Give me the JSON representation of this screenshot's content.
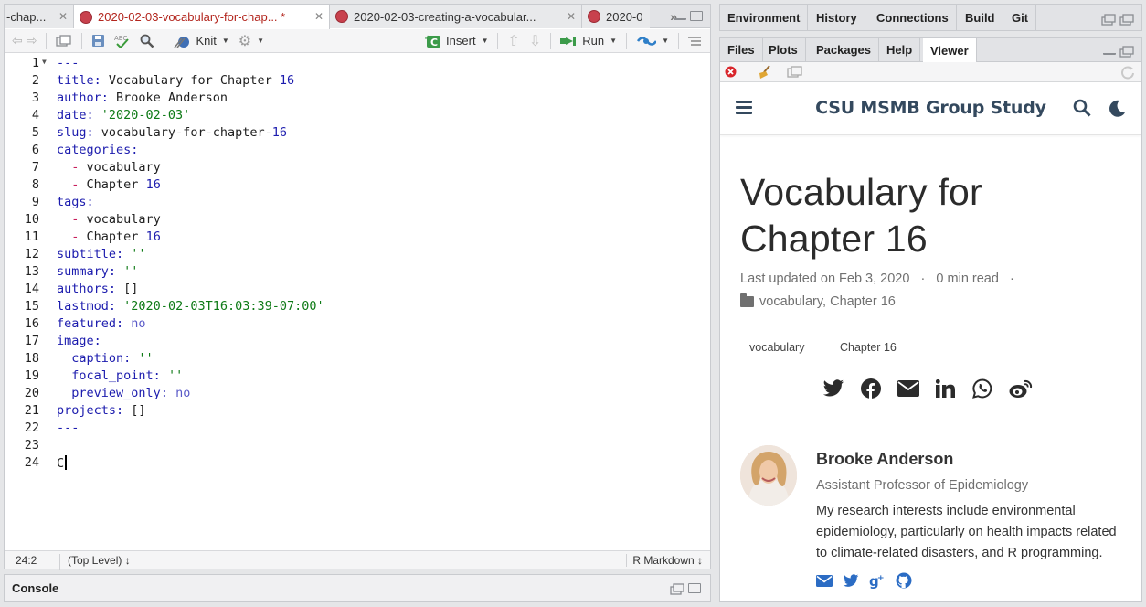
{
  "editor": {
    "tabs": [
      {
        "label": "-chap...",
        "active": false
      },
      {
        "label": "2020-02-03-vocabulary-for-chap... *",
        "active": true
      },
      {
        "label": "2020-02-03-creating-a-vocabular...",
        "active": false
      },
      {
        "label": "2020-0",
        "active": false
      }
    ],
    "toolbar": {
      "knit_label": "Knit",
      "insert_label": "Insert",
      "run_label": "Run"
    },
    "lines": [
      {
        "n": "1",
        "fold": true
      },
      {
        "n": "2"
      },
      {
        "n": "3"
      },
      {
        "n": "4"
      },
      {
        "n": "5"
      },
      {
        "n": "6"
      },
      {
        "n": "7"
      },
      {
        "n": "8"
      },
      {
        "n": "9"
      },
      {
        "n": "10"
      },
      {
        "n": "11"
      },
      {
        "n": "12"
      },
      {
        "n": "13"
      },
      {
        "n": "14"
      },
      {
        "n": "15"
      },
      {
        "n": "16"
      },
      {
        "n": "17"
      },
      {
        "n": "18"
      },
      {
        "n": "19"
      },
      {
        "n": "20"
      },
      {
        "n": "21"
      },
      {
        "n": "22"
      },
      {
        "n": "23"
      },
      {
        "n": "24"
      }
    ],
    "code": {
      "l1": "---",
      "l2_key": "title:",
      "l2_val": "Vocabulary for Chapter ",
      "l2_num": "16",
      "l3_key": "author:",
      "l3_val": "Brooke Anderson",
      "l4_key": "date:",
      "l4_val": "'2020-02-03'",
      "l5_key": "slug:",
      "l5_val": "vocabulary-for-chapter-",
      "l5_num": "16",
      "l6_key": "categories:",
      "l7_dash": "  -",
      "l7_val": "vocabulary",
      "l8_dash": "  -",
      "l8_val": "Chapter ",
      "l8_num": "16",
      "l9_key": "tags:",
      "l10_dash": "  -",
      "l10_val": "vocabulary",
      "l11_dash": "  -",
      "l11_val": "Chapter ",
      "l11_num": "16",
      "l12_key": "subtitle:",
      "l12_val": "''",
      "l13_key": "summary:",
      "l13_val": "''",
      "l14_key": "authors:",
      "l14_val": "[]",
      "l15_key": "lastmod:",
      "l15_val": "'2020-02-03T16:03:39-07:00'",
      "l16_key": "featured:",
      "l16_val": "no",
      "l17_key": "image:",
      "l18_key": "  caption:",
      "l18_val": "''",
      "l19_key": "  focal_point:",
      "l19_val": "''",
      "l20_key": "  preview_only:",
      "l20_val": "no",
      "l21_key": "projects:",
      "l21_val": "[]",
      "l22": "---",
      "l23": "",
      "l24": "C"
    },
    "status": {
      "position": "24:2",
      "scope": "(Top Level) ↕",
      "mode": "R Markdown ↕"
    }
  },
  "console": {
    "title": "Console"
  },
  "env_tabs": [
    "Environment",
    "History",
    "Connections",
    "Build",
    "Git"
  ],
  "viewer_tabs": [
    "Files",
    "Plots",
    "Packages",
    "Help",
    "Viewer"
  ],
  "site": {
    "title": "CSU MSMB Group Study",
    "post_title": "Vocabulary for Chapter 16",
    "meta": "Last updated on Feb 3, 2020   ·   0 min read   ·",
    "categories": "vocabulary, Chapter 16",
    "tags": [
      "vocabulary",
      "Chapter 16"
    ],
    "author_name": "Brooke Anderson",
    "author_role": "Assistant Professor of Epidemiology",
    "author_bio": "My research interests include environmental epidemiology, particularly on health impacts related to climate-related disasters, and R programming."
  },
  "colors": {
    "accent": "#2b6cc4",
    "site_dark": "#34495e",
    "yaml_key": "#1c1cae",
    "yaml_string": "#0e7a16"
  }
}
